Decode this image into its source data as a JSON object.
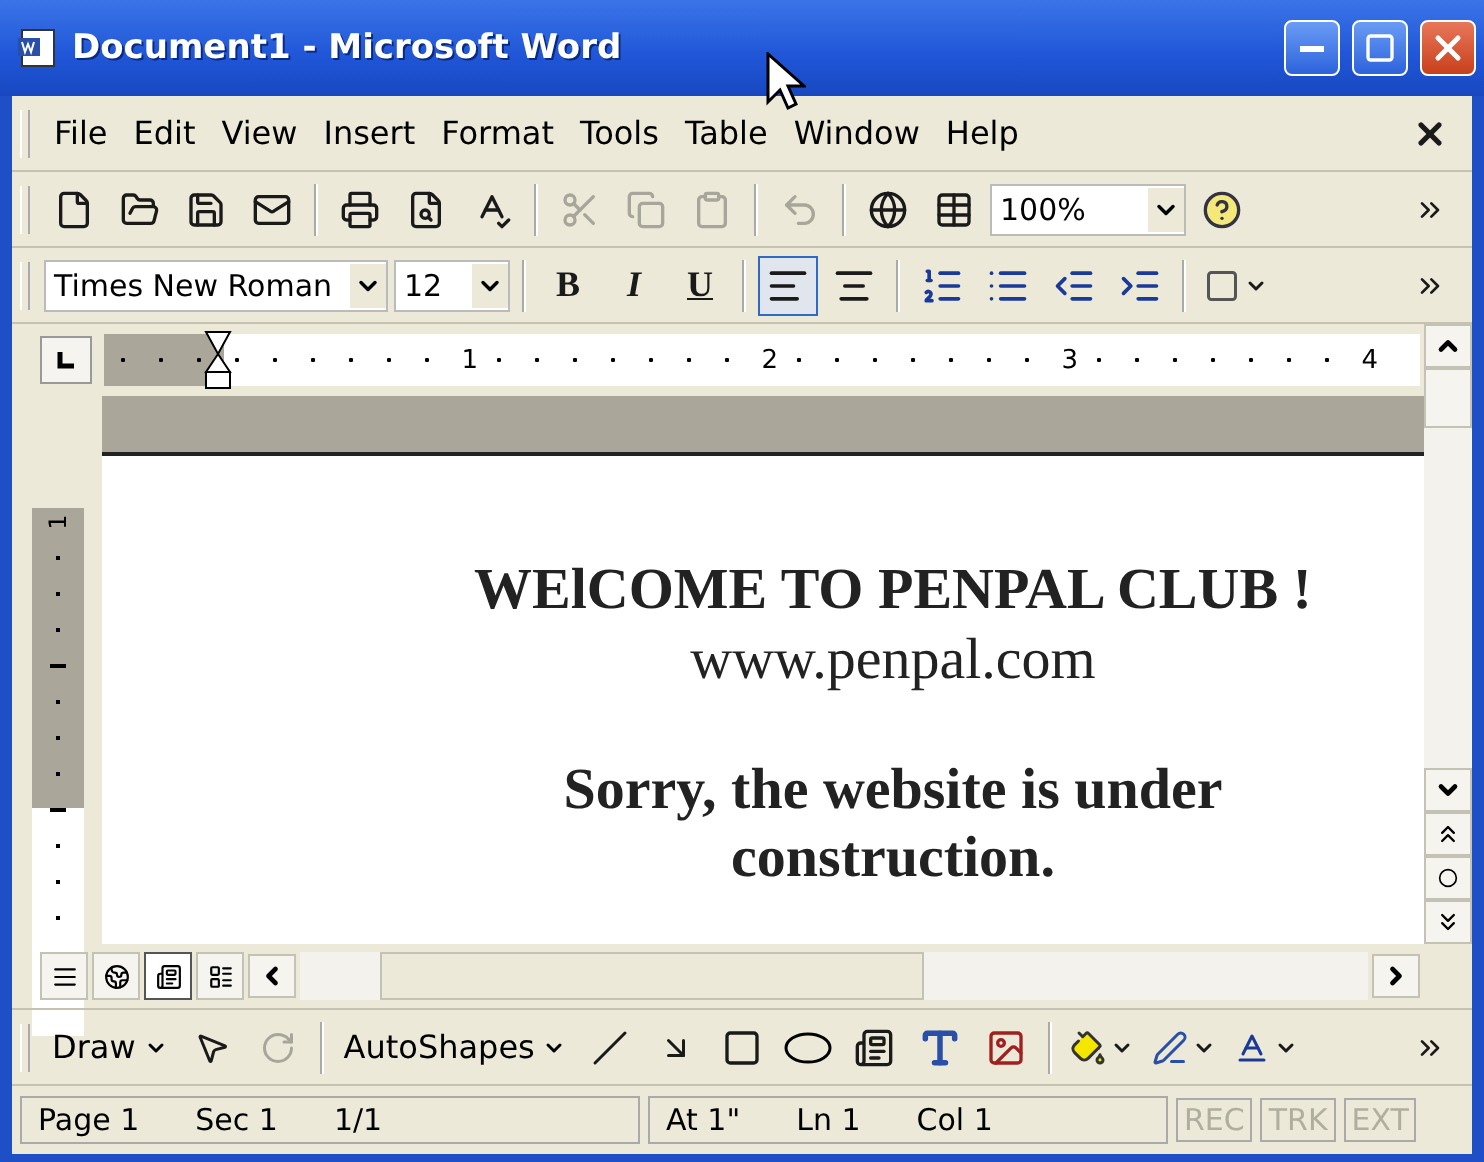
{
  "window": {
    "title": "Document1 - Microsoft Word"
  },
  "menu": [
    {
      "label": "File"
    },
    {
      "label": "Edit"
    },
    {
      "label": "View"
    },
    {
      "label": "Insert"
    },
    {
      "label": "Format"
    },
    {
      "label": "Tools"
    },
    {
      "label": "Table"
    },
    {
      "label": "Window"
    },
    {
      "label": "Help"
    }
  ],
  "standard_toolbar": {
    "zoom": "100%",
    "buttons": [
      {
        "disabled": false
      },
      {
        "disabled": false
      },
      {
        "disabled": false
      },
      {
        "disabled": false
      },
      {
        "disabled": false
      },
      {
        "disabled": false
      },
      {
        "disabled": false
      },
      {
        "disabled": true
      },
      {
        "disabled": true
      },
      {
        "disabled": true
      },
      {
        "disabled": true
      },
      {
        "disabled": false
      },
      {
        "disabled": false
      },
      {
        "disabled": false
      }
    ]
  },
  "formatting_toolbar": {
    "font": "Times New Roman",
    "size": "12",
    "styles": [
      {
        "label": "B",
        "selected": false
      },
      {
        "label": "I",
        "selected": false
      },
      {
        "label": "U",
        "selected": false
      }
    ],
    "alignment": [
      {
        "selected": true
      },
      {
        "selected": false
      }
    ]
  },
  "ruler": {
    "numbers": [
      "1",
      "2",
      "3",
      "4"
    ],
    "vertical_number": "1"
  },
  "document": {
    "header": [
      {
        "text": "WElCOME TO PENPAL CLUB !",
        "bold": true
      },
      {
        "text": "www.penpal.com",
        "bold": false
      }
    ],
    "notice": {
      "text": "Sorry, the website is under construction.",
      "bold": true
    }
  },
  "view_buttons": [
    {
      "selected": false
    },
    {
      "selected": false
    },
    {
      "selected": true
    },
    {
      "selected": false
    }
  ],
  "drawing_toolbar": {
    "draw": "Draw",
    "autoshapes": "AutoShapes"
  },
  "status_bar": {
    "fields": [
      "Page 1",
      "Sec 1",
      "1/1",
      "At 1\"",
      "Ln 1",
      "Col 1"
    ],
    "indicators": [
      {
        "label": "REC",
        "disabled": true
      },
      {
        "label": "TRK",
        "disabled": true
      },
      {
        "label": "EXT",
        "disabled": true
      }
    ]
  }
}
